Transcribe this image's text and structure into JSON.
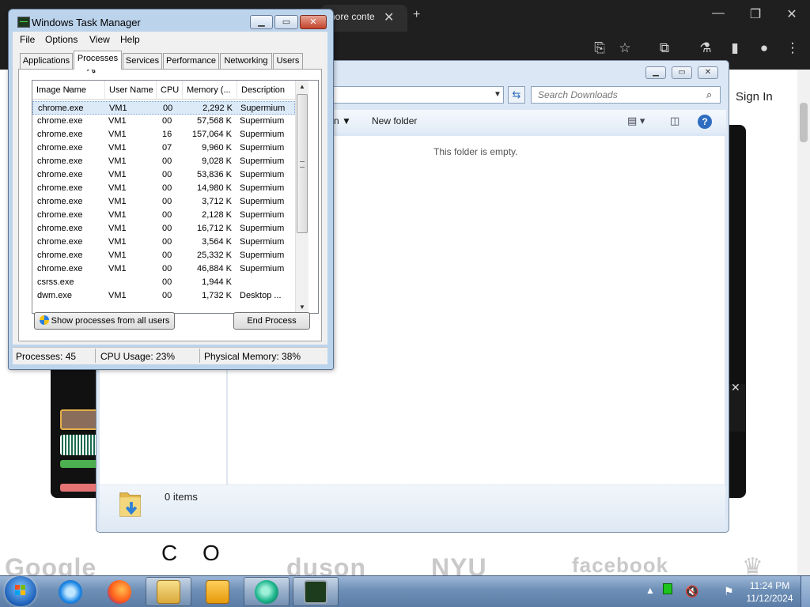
{
  "browser": {
    "tab_title": "hore conte",
    "sign_in": "Sign In",
    "logos": [
      "Google",
      "duson",
      "NYU",
      "facebook"
    ],
    "letters": [
      "C",
      "O"
    ]
  },
  "explorer": {
    "search_placeholder": "Search Downloads",
    "new_folder": "New folder",
    "empty_message": "This folder is empty.",
    "items_count": "0 items"
  },
  "taskmgr": {
    "title": "Windows Task Manager",
    "menu": [
      "File",
      "Options",
      "View",
      "Help"
    ],
    "tabs": [
      "Applications",
      "Processes",
      "Services",
      "Performance",
      "Networking",
      "Users"
    ],
    "active_tab": "Processes",
    "columns": [
      "Image Name",
      "User Name",
      "CPU",
      "Memory (...",
      "Description"
    ],
    "rows": [
      {
        "name": "chrome.exe",
        "user": "VM1",
        "cpu": "00",
        "mem": "2,292 K",
        "desc": "Supermium",
        "selected": true
      },
      {
        "name": "chrome.exe",
        "user": "VM1",
        "cpu": "00",
        "mem": "57,568 K",
        "desc": "Supermium"
      },
      {
        "name": "chrome.exe",
        "user": "VM1",
        "cpu": "16",
        "mem": "157,064 K",
        "desc": "Supermium"
      },
      {
        "name": "chrome.exe",
        "user": "VM1",
        "cpu": "07",
        "mem": "9,960 K",
        "desc": "Supermium"
      },
      {
        "name": "chrome.exe",
        "user": "VM1",
        "cpu": "00",
        "mem": "9,028 K",
        "desc": "Supermium"
      },
      {
        "name": "chrome.exe",
        "user": "VM1",
        "cpu": "00",
        "mem": "53,836 K",
        "desc": "Supermium"
      },
      {
        "name": "chrome.exe",
        "user": "VM1",
        "cpu": "00",
        "mem": "14,980 K",
        "desc": "Supermium"
      },
      {
        "name": "chrome.exe",
        "user": "VM1",
        "cpu": "00",
        "mem": "3,712 K",
        "desc": "Supermium"
      },
      {
        "name": "chrome.exe",
        "user": "VM1",
        "cpu": "00",
        "mem": "2,128 K",
        "desc": "Supermium"
      },
      {
        "name": "chrome.exe",
        "user": "VM1",
        "cpu": "00",
        "mem": "16,712 K",
        "desc": "Supermium"
      },
      {
        "name": "chrome.exe",
        "user": "VM1",
        "cpu": "00",
        "mem": "3,564 K",
        "desc": "Supermium"
      },
      {
        "name": "chrome.exe",
        "user": "VM1",
        "cpu": "00",
        "mem": "25,332 K",
        "desc": "Supermium"
      },
      {
        "name": "chrome.exe",
        "user": "VM1",
        "cpu": "00",
        "mem": "46,884 K",
        "desc": "Supermium"
      },
      {
        "name": "csrss.exe",
        "user": "",
        "cpu": "00",
        "mem": "1,944 K",
        "desc": ""
      },
      {
        "name": "dwm.exe",
        "user": "VM1",
        "cpu": "00",
        "mem": "1,732 K",
        "desc": "Desktop ..."
      }
    ],
    "show_all_button": "Show processes from all users",
    "end_process_button": "End Process",
    "status": {
      "processes": "Processes: 45",
      "cpu": "CPU Usage: 23%",
      "memory": "Physical Memory: 38%"
    }
  },
  "taskbar": {
    "clock_time": "11:24 PM",
    "clock_date": "11/12/2024"
  },
  "colors": {
    "taskbar": "#6e8fb6",
    "window_frame": "#bcd3ec",
    "selection": "#dceaf8"
  }
}
